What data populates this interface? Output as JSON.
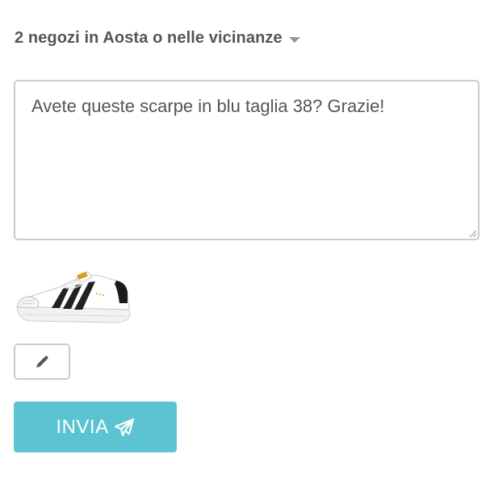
{
  "store_selector": {
    "label": "2 negozi in Aosta o nelle vicinanze",
    "icon": "caret-down-icon"
  },
  "message": {
    "value": "Avete queste scarpe in blu taglia 38? Grazie!"
  },
  "product": {
    "image": "sneaker-image"
  },
  "edit": {
    "icon": "pencil-icon"
  },
  "send": {
    "label": "INVIA",
    "icon": "paper-plane-icon",
    "color": "#5bc3d2"
  }
}
